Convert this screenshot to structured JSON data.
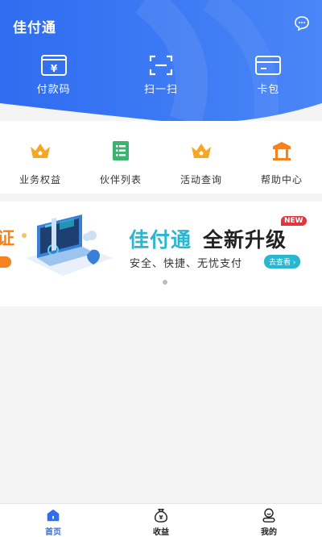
{
  "header": {
    "title": "佳付通",
    "quick_actions": [
      {
        "label": "付款码",
        "icon": "payment-code-icon"
      },
      {
        "label": "扫一扫",
        "icon": "scan-icon"
      },
      {
        "label": "卡包",
        "icon": "card-wallet-icon"
      }
    ],
    "colors": {
      "start": "#2f6cf0",
      "end": "#4a86f7"
    }
  },
  "services": [
    {
      "label": "业务权益",
      "icon": "crown-icon",
      "color": "#f5a623"
    },
    {
      "label": "伙伴列表",
      "icon": "list-icon",
      "color": "#3cb371"
    },
    {
      "label": "活动查询",
      "icon": "crown-icon",
      "color": "#f5a623"
    },
    {
      "label": "帮助中心",
      "icon": "pavilion-icon",
      "color": "#f5821f"
    }
  ],
  "banner": {
    "prev_slide_text": "证",
    "brand": "佳付通",
    "headline": "全新升级",
    "badge": "NEW",
    "subtitle": "安全、快捷、无忧支付",
    "cta": "去查看 ›",
    "accent": "#2bb6cf"
  },
  "tabbar": {
    "active_color": "#2f6cf0",
    "tabs": [
      {
        "label": "首页",
        "icon": "home-icon",
        "active": true
      },
      {
        "label": "收益",
        "icon": "money-bag-icon",
        "active": false
      },
      {
        "label": "我的",
        "icon": "profile-icon",
        "active": false
      }
    ]
  }
}
